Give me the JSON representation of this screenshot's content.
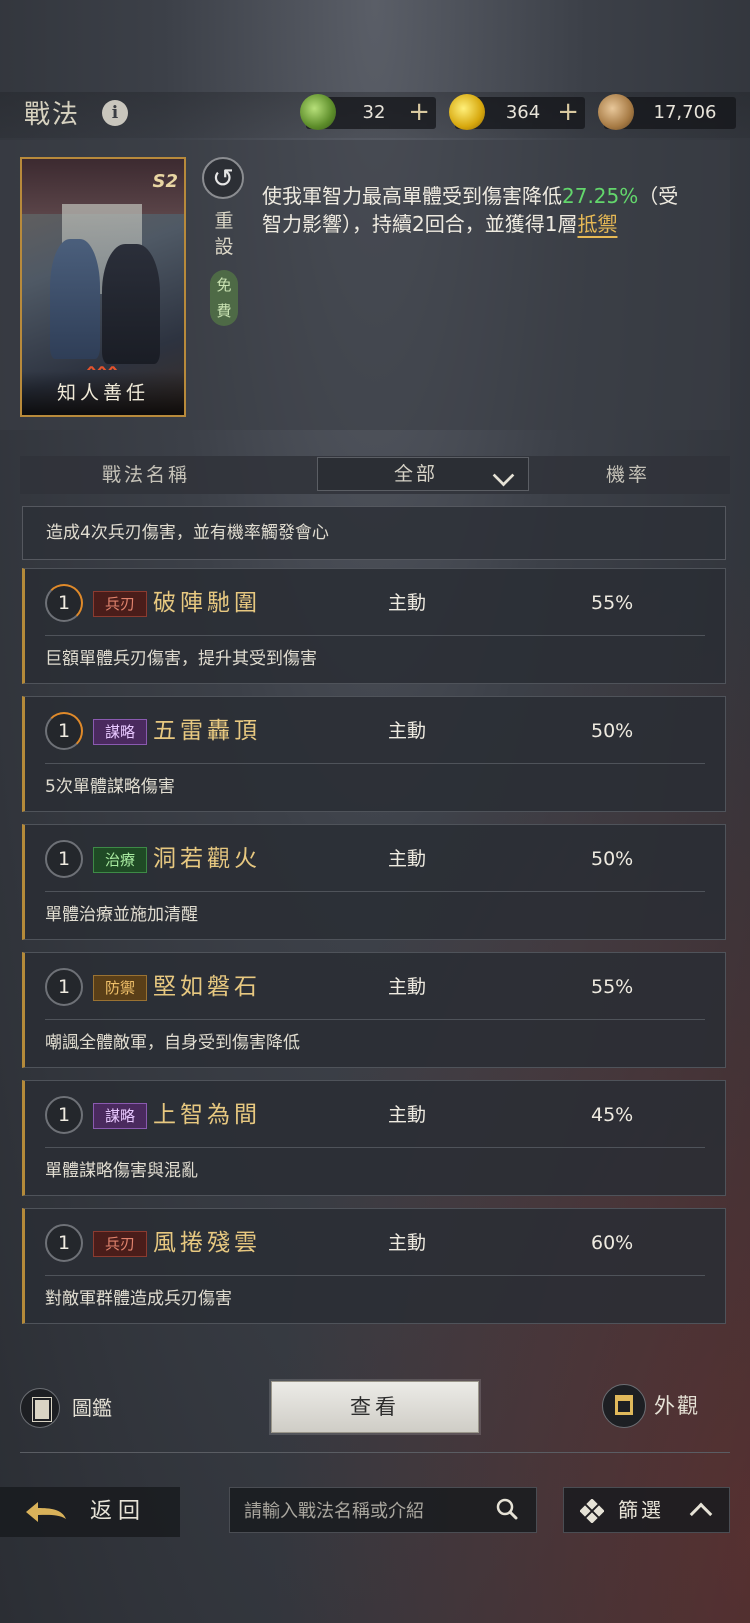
{
  "header": {
    "title": "戰法",
    "info_icon": "i",
    "currencies": [
      {
        "name": "jade-icon",
        "value": "32",
        "plus": "+"
      },
      {
        "name": "gold-icon",
        "value": "364",
        "plus": "+"
      },
      {
        "name": "copper-icon",
        "value": "17,706"
      }
    ]
  },
  "selected_skill": {
    "card_name": "知人善任",
    "season": "S2",
    "marks": "ꞈꞈꞈ",
    "reset_label": "重設",
    "free_label": "免費",
    "desc_part1": "使我軍智力最高單體受到傷害降低",
    "desc_highlight": "27.25%",
    "desc_part2": "（受智力影響），持續2回合，並獲得1層",
    "desc_link": "抵禦",
    "highlight_color": "#63d66c",
    "link_color": "#e7b955"
  },
  "columns": {
    "name": "戰法名稱",
    "filter": "全部",
    "rate": "機率"
  },
  "partial_row": {
    "desc": "造成4次兵刃傷害，並有機率觸發會心"
  },
  "skills": [
    {
      "level": "1",
      "tag": "兵刃",
      "tag_type": "bing",
      "name": "破陣馳圍",
      "type": "主動",
      "rate": "55%",
      "desc": "巨額單體兵刃傷害，提升其受到傷害"
    },
    {
      "level": "1",
      "tag": "謀略",
      "tag_type": "mou",
      "name": "五雷轟頂",
      "type": "主動",
      "rate": "50%",
      "desc": "5次單體謀略傷害"
    },
    {
      "level": "1",
      "tag": "治療",
      "tag_type": "zhi",
      "name": "洞若觀火",
      "type": "主動",
      "rate": "50%",
      "desc": "單體治療並施加清醒"
    },
    {
      "level": "1",
      "tag": "防禦",
      "tag_type": "fang",
      "name": "堅如磐石",
      "type": "主動",
      "rate": "55%",
      "desc": "嘲諷全體敵軍，自身受到傷害降低"
    },
    {
      "level": "1",
      "tag": "謀略",
      "tag_type": "mou",
      "name": "上智為間",
      "type": "主動",
      "rate": "45%",
      "desc": "單體謀略傷害與混亂"
    },
    {
      "level": "1",
      "tag": "兵刃",
      "tag_type": "bing",
      "name": "風捲殘雲",
      "type": "主動",
      "rate": "60%",
      "desc": "對敵軍群體造成兵刃傷害"
    }
  ],
  "actions": {
    "codex_label": "圖鑑",
    "view_label": "查看",
    "appearance_label": "外觀"
  },
  "footer": {
    "back_label": "返回",
    "search_placeholder": "請輸入戰法名稱或介紹",
    "filter_label": "篩選"
  }
}
